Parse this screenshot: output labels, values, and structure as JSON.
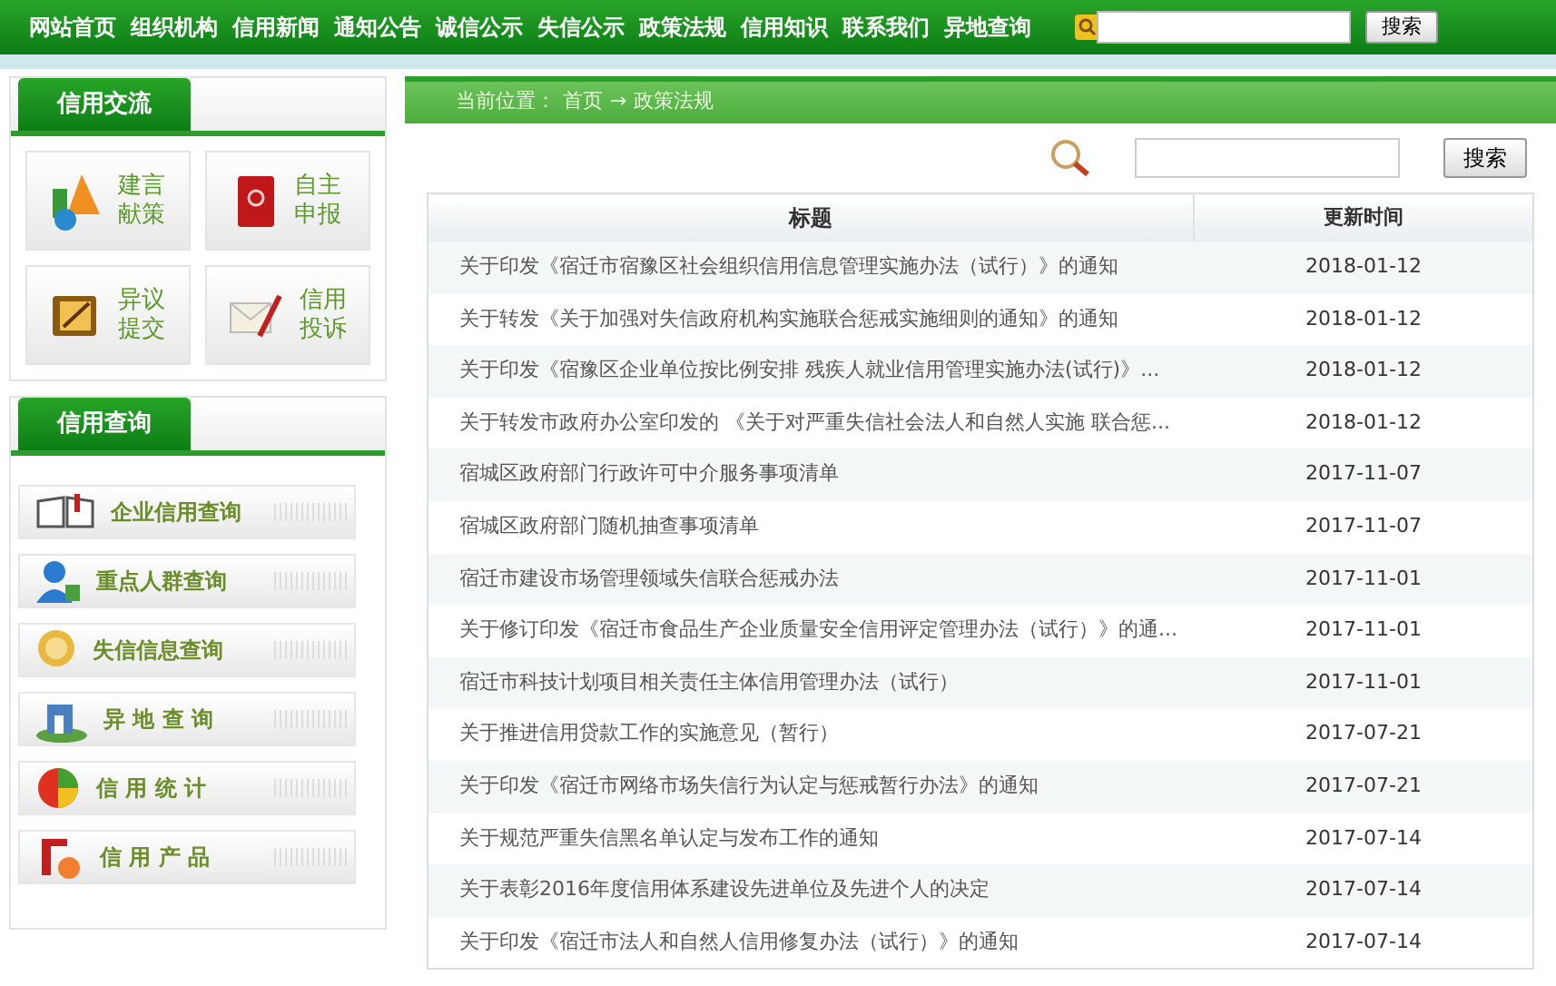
{
  "nav": {
    "items": [
      "网站首页",
      "组织机构",
      "信用新闻",
      "通知公告",
      "诚信公示",
      "失信公示",
      "政策法规",
      "信用知识",
      "联系我们",
      "异地查询"
    ],
    "search_button": "搜索"
  },
  "sidebar": [
    {
      "title": "信用交流",
      "kind": "tiles",
      "items": [
        {
          "label": "建言献策"
        },
        {
          "label": "自主申报"
        },
        {
          "label": "异议提交"
        },
        {
          "label": "信用投诉"
        }
      ]
    },
    {
      "title": "信用查询",
      "kind": "list",
      "items": [
        {
          "label": "企业信用查询"
        },
        {
          "label": "重点人群查询"
        },
        {
          "label": "失信信息查询"
        },
        {
          "label": "异 地 查 询"
        },
        {
          "label": "信 用 统 计"
        },
        {
          "label": "信 用 产 品"
        }
      ]
    }
  ],
  "breadcrumb": {
    "label": "当前位置：",
    "home": "首页",
    "separator": "→",
    "current": "政策法规"
  },
  "search": {
    "button": "搜索"
  },
  "table": {
    "columns": [
      "标题",
      "更新时间"
    ],
    "rows": [
      [
        "关于印发《宿迁市宿豫区社会组织信用信息管理实施办法（试行）》的通知",
        "2018-01-12"
      ],
      [
        "关于转发《关于加强对失信政府机构实施联合惩戒实施细则的通知》的通知",
        "2018-01-12"
      ],
      [
        "关于印发《宿豫区企业单位按比例安排 残疾人就业信用管理实施办法(试行)》...",
        "2018-01-12"
      ],
      [
        "关于转发市政府办公室印发的 《关于对严重失信社会法人和自然人实施 联合惩...",
        "2018-01-12"
      ],
      [
        "宿城区政府部门行政许可中介服务事项清单",
        "2017-11-07"
      ],
      [
        "宿城区政府部门随机抽查事项清单",
        "2017-11-07"
      ],
      [
        "宿迁市建设市场管理领域失信联合惩戒办法",
        "2017-11-01"
      ],
      [
        "关于修订印发《宿迁市食品生产企业质量安全信用评定管理办法（试行）》的通...",
        "2017-11-01"
      ],
      [
        "宿迁市科技计划项目相关责任主体信用管理办法（试行）",
        "2017-11-01"
      ],
      [
        "关于推进信用贷款工作的实施意见（暂行）",
        "2017-07-21"
      ],
      [
        "关于印发《宿迁市网络市场失信行为认定与惩戒暂行办法》的通知",
        "2017-07-21"
      ],
      [
        "关于规范严重失信黑名单认定与发布工作的通知",
        "2017-07-14"
      ],
      [
        "关于表彰2016年度信用体系建设先进单位及先进个人的决定",
        "2017-07-14"
      ],
      [
        "关于印发《宿迁市法人和自然人信用修复办法（试行）》的通知",
        "2017-07-14"
      ]
    ]
  }
}
